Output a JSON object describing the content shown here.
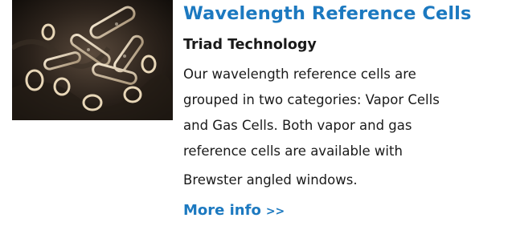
{
  "product": {
    "title": "Wavelength Reference Cells",
    "company": "Triad Technology",
    "description_lines": [
      "Our wavelength reference cells are",
      "grouped in two categories: Vapor Cells",
      "and Gas Cells. Both vapor and gas",
      "reference cells are available with",
      "Brewster angled windows."
    ],
    "more_link": {
      "label": "More info",
      "arrows": ">>"
    }
  },
  "colors": {
    "link_blue": "#1c79c0",
    "body_text": "#1a1a1a",
    "background": "#ffffff"
  }
}
